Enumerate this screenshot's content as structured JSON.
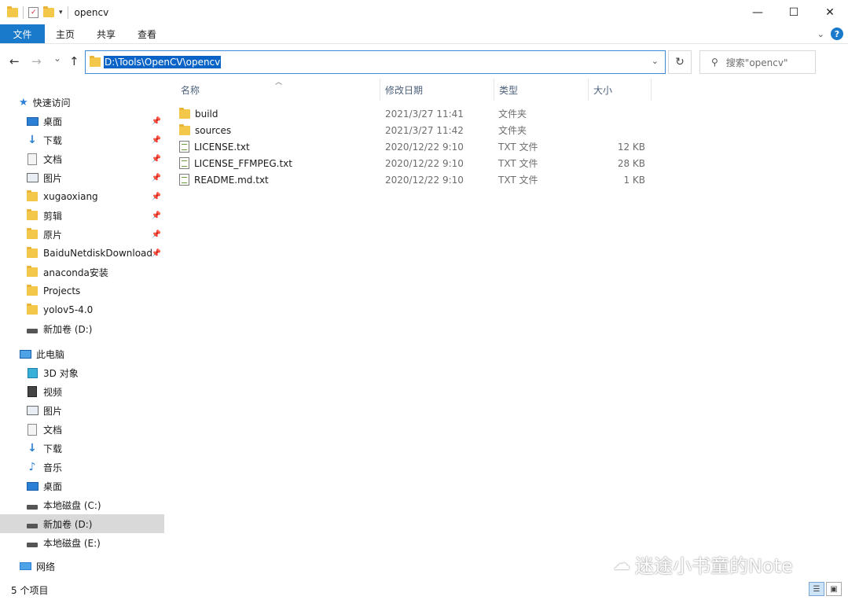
{
  "window": {
    "title": "opencv",
    "minimize": "—",
    "maximize": "☐",
    "close": "✕"
  },
  "ribbon": {
    "tabs": [
      "文件",
      "主页",
      "共享",
      "查看"
    ]
  },
  "nav": {
    "back": "←",
    "forward": "→",
    "recent": "⌄",
    "up": "↑",
    "address": "D:\\Tools\\OpenCV\\opencv",
    "refresh": "↻",
    "search_placeholder": "搜索\"opencv\""
  },
  "sidebar": {
    "quick_access_label": "快速访问",
    "quick_items": [
      {
        "label": "桌面",
        "icon": "desktop-icon",
        "pinned": true
      },
      {
        "label": "下载",
        "icon": "download-icon",
        "pinned": true
      },
      {
        "label": "文档",
        "icon": "document-icon",
        "pinned": true
      },
      {
        "label": "图片",
        "icon": "picture-icon",
        "pinned": true
      },
      {
        "label": "xugaoxiang",
        "icon": "folder-icon",
        "pinned": true
      },
      {
        "label": "剪辑",
        "icon": "folder-icon",
        "pinned": true
      },
      {
        "label": "原片",
        "icon": "folder-icon",
        "pinned": true
      },
      {
        "label": "BaiduNetdiskDownload",
        "icon": "folder-icon",
        "pinned": true
      },
      {
        "label": "anaconda安装",
        "icon": "folder-icon",
        "pinned": false
      },
      {
        "label": "Projects",
        "icon": "folder-icon",
        "pinned": false
      },
      {
        "label": "yolov5-4.0",
        "icon": "folder-icon",
        "pinned": false
      },
      {
        "label": "新加卷 (D:)",
        "icon": "drive-icon",
        "pinned": false
      }
    ],
    "this_pc_label": "此电脑",
    "pc_items": [
      {
        "label": "3D 对象",
        "icon": "3d-objects-icon"
      },
      {
        "label": "视频",
        "icon": "video-icon"
      },
      {
        "label": "图片",
        "icon": "picture-icon"
      },
      {
        "label": "文档",
        "icon": "document-icon"
      },
      {
        "label": "下载",
        "icon": "download-icon"
      },
      {
        "label": "音乐",
        "icon": "music-icon"
      },
      {
        "label": "桌面",
        "icon": "desktop-icon"
      },
      {
        "label": "本地磁盘 (C:)",
        "icon": "drive-icon"
      },
      {
        "label": "新加卷 (D:)",
        "icon": "drive-icon",
        "selected": true
      },
      {
        "label": "本地磁盘 (E:)",
        "icon": "drive-icon"
      }
    ],
    "network_label": "网络"
  },
  "columns": {
    "name": "名称",
    "date": "修改日期",
    "type": "类型",
    "size": "大小"
  },
  "files": [
    {
      "name": "build",
      "date": "2021/3/27 11:41",
      "type": "文件夹",
      "size": "",
      "icon": "folder-icon"
    },
    {
      "name": "sources",
      "date": "2021/3/27 11:42",
      "type": "文件夹",
      "size": "",
      "icon": "folder-icon"
    },
    {
      "name": "LICENSE.txt",
      "date": "2020/12/22 9:10",
      "type": "TXT 文件",
      "size": "12 KB",
      "icon": "text-file-icon"
    },
    {
      "name": "LICENSE_FFMPEG.txt",
      "date": "2020/12/22 9:10",
      "type": "TXT 文件",
      "size": "28 KB",
      "icon": "text-file-icon"
    },
    {
      "name": "README.md.txt",
      "date": "2020/12/22 9:10",
      "type": "TXT 文件",
      "size": "1 KB",
      "icon": "text-file-icon"
    }
  ],
  "status": {
    "item_count": "5 个项目"
  },
  "watermark": "迷途小书童的Note",
  "colors": {
    "accent": "#1979ca",
    "selection": "#0a64c8",
    "folder": "#f3c84a"
  }
}
